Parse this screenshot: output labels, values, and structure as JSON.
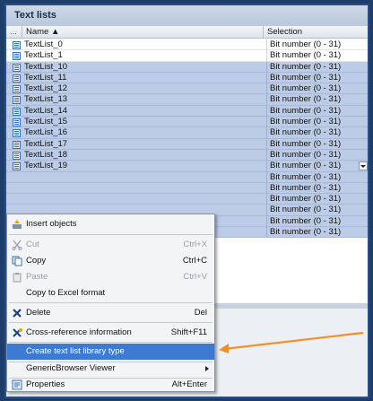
{
  "panel": {
    "title": "Text lists",
    "columns": {
      "dots": "...",
      "name": "Name ▲",
      "selection": "Selection"
    }
  },
  "rows": [
    {
      "name": "TextList_0",
      "selection": "Bit number (0 - 31)",
      "selected": false
    },
    {
      "name": "TextList_1",
      "selection": "Bit number (0 - 31)",
      "selected": false
    },
    {
      "name": "TextList_10",
      "selection": "Bit number (0 - 31)",
      "selected": true
    },
    {
      "name": "TextList_11",
      "selection": "Bit number (0 - 31)",
      "selected": true
    },
    {
      "name": "TextList_12",
      "selection": "Bit number (0 - 31)",
      "selected": true
    },
    {
      "name": "TextList_13",
      "selection": "Bit number (0 - 31)",
      "selected": true
    },
    {
      "name": "TextList_14",
      "selection": "Bit number (0 - 31)",
      "selected": true
    },
    {
      "name": "TextList_15",
      "selection": "Bit number (0 - 31)",
      "selected": true
    },
    {
      "name": "TextList_16",
      "selection": "Bit number (0 - 31)",
      "selected": true
    },
    {
      "name": "TextList_17",
      "selection": "Bit number (0 - 31)",
      "selected": true
    },
    {
      "name": "TextList_18",
      "selection": "Bit number (0 - 31)",
      "selected": true
    },
    {
      "name": "TextList_19",
      "selection": "Bit number (0 - 31)",
      "selected": true,
      "dropdown": true
    },
    {
      "name": "",
      "selection": "Bit number (0 - 31)",
      "selected": true
    },
    {
      "name": "",
      "selection": "Bit number (0 - 31)",
      "selected": true
    },
    {
      "name": "",
      "selection": "Bit number (0 - 31)",
      "selected": true
    },
    {
      "name": "",
      "selection": "Bit number (0 - 31)",
      "selected": true
    },
    {
      "name": "",
      "selection": "Bit number (0 - 31)",
      "selected": true
    },
    {
      "name": "",
      "selection": "Bit number (0 - 31)",
      "selected": true
    }
  ],
  "context_menu": {
    "insert_objects": "Insert objects",
    "cut": {
      "label": "Cut",
      "shortcut": "Ctrl+X"
    },
    "copy": {
      "label": "Copy",
      "shortcut": "Ctrl+C"
    },
    "paste": {
      "label": "Paste",
      "shortcut": "Ctrl+V"
    },
    "copy_excel": "Copy to Excel format",
    "delete": {
      "label": "Delete",
      "shortcut": "Del"
    },
    "crossref": {
      "label": "Cross-reference information",
      "shortcut": "Shift+F11"
    },
    "create_library_type": "Create text list library type",
    "generic_browser": "GenericBrowser Viewer",
    "properties": {
      "label": "Properties",
      "shortcut": "Alt+Enter"
    }
  },
  "colors": {
    "background": "#1d3d6b",
    "selection": "#bccbe6",
    "highlight": "#3c7ad4",
    "arrow": "#f0902a"
  },
  "icons": {
    "row": "text-list-icon",
    "insert": "insert-objects-icon",
    "cut": "scissors-icon",
    "copy": "copy-icon",
    "paste": "paste-icon",
    "delete": "delete-x-icon",
    "crossref": "cross-reference-icon",
    "properties": "properties-icon",
    "submenu": "chevron-right-icon",
    "dropdown": "chevron-down-icon"
  }
}
